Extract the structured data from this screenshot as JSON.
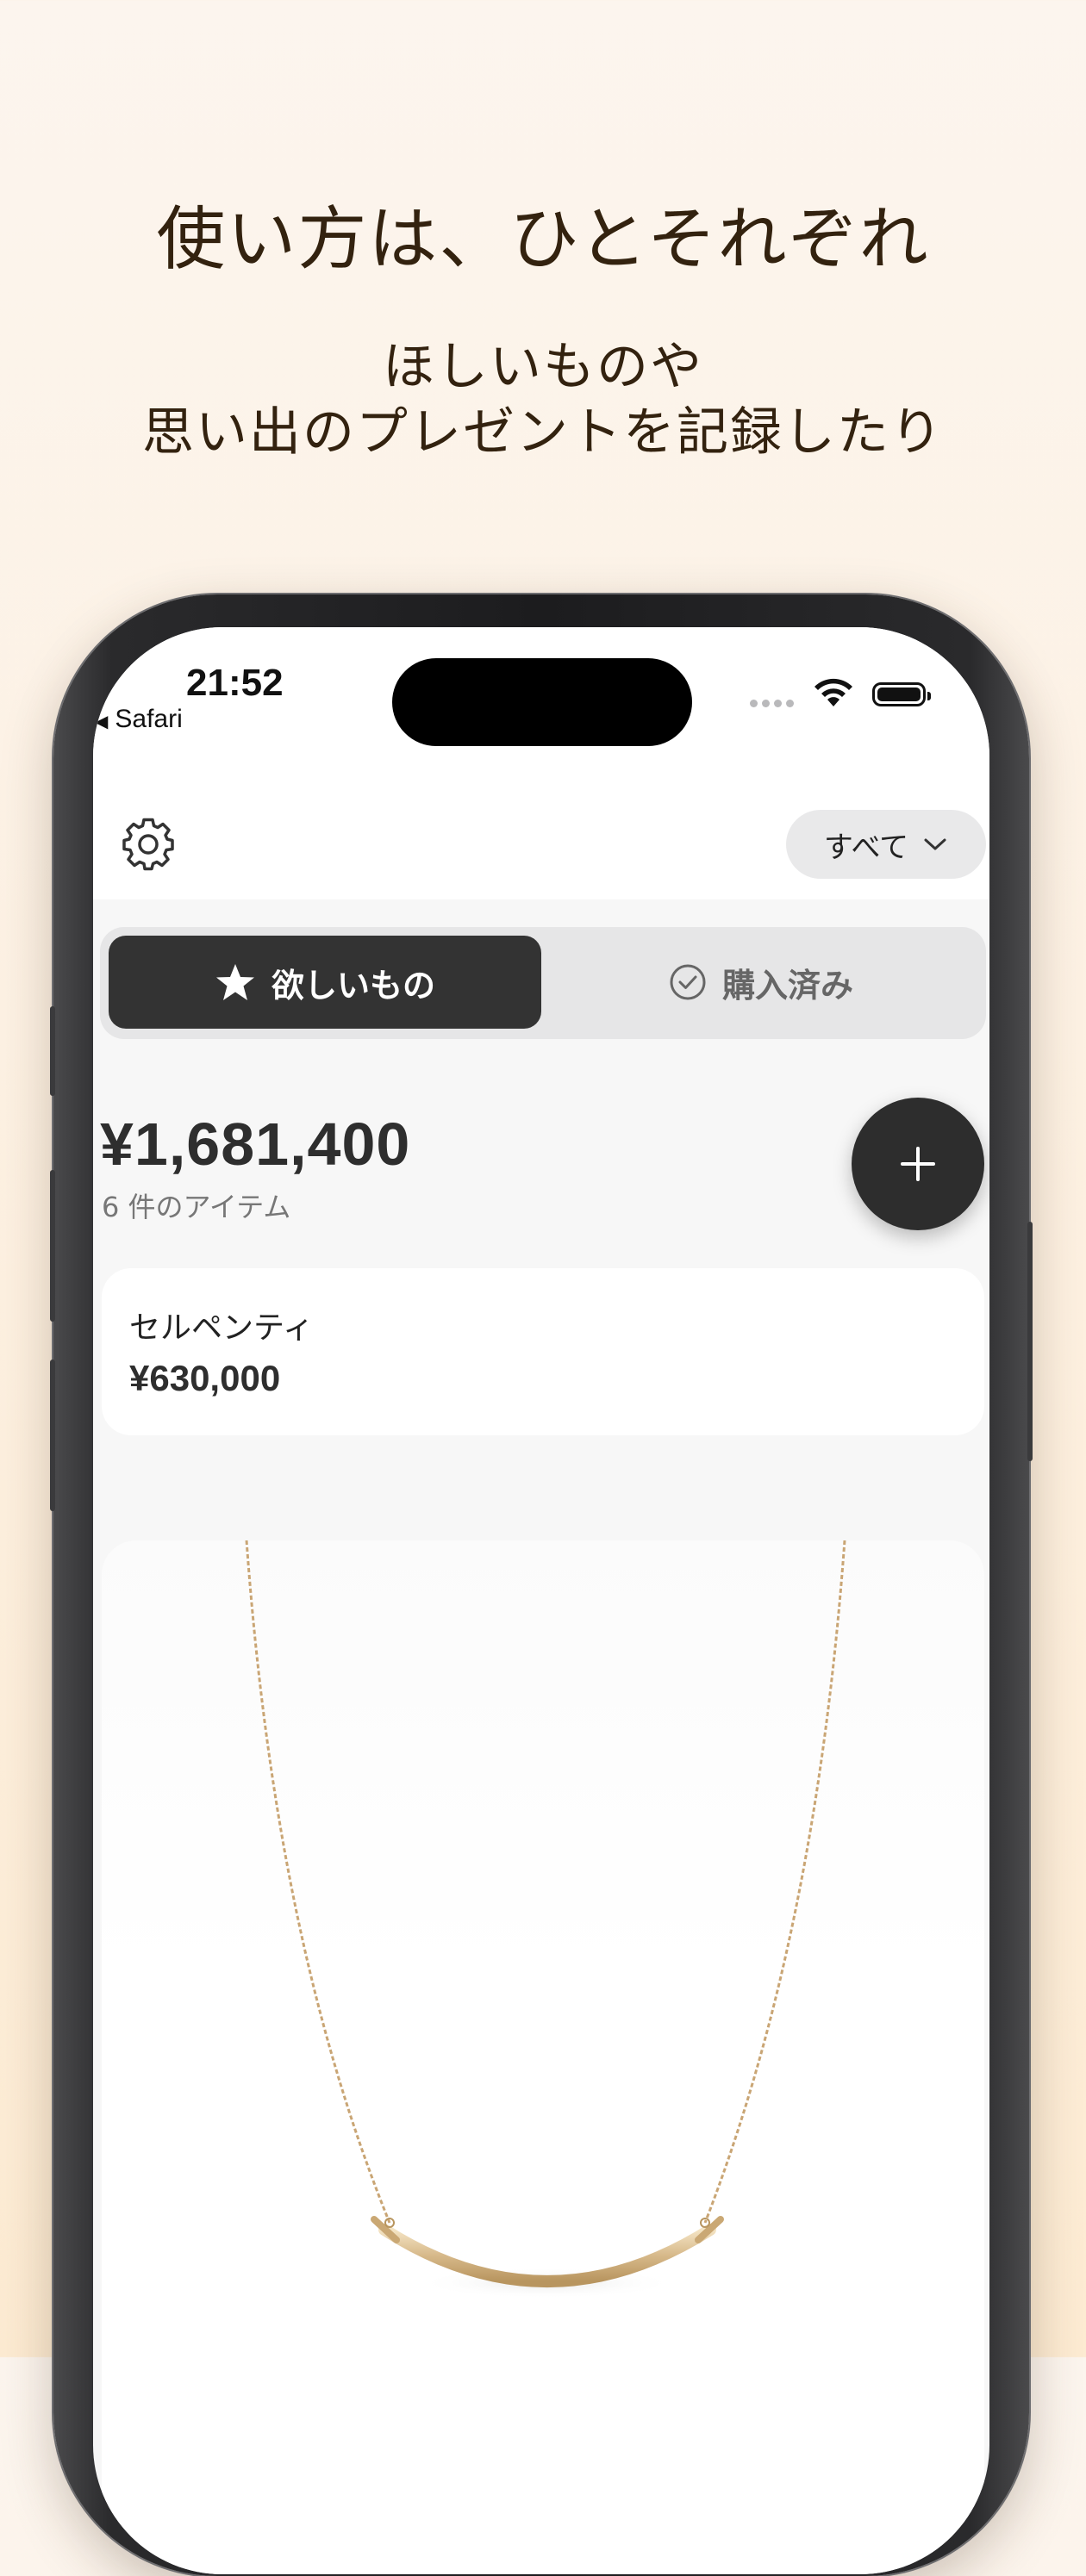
{
  "promo": {
    "headline": "使い方は、ひとそれぞれ",
    "subline_1": "ほしいものや",
    "subline_2": "思い出のプレゼントを記録したり"
  },
  "status_bar": {
    "time": "21:52",
    "back_app": "Safari",
    "battery_level": 1.0
  },
  "navbar": {
    "settings_icon": "gear-icon",
    "filter_label": "すべて",
    "filter_icon": "chevron-down-icon"
  },
  "tabs": {
    "wishlist_label": "欲しいもの",
    "wishlist_icon": "star-icon",
    "purchased_label": "購入済み",
    "purchased_icon": "check-circle-icon",
    "active": "wishlist"
  },
  "summary": {
    "total": "¥1,681,400",
    "count": "6 件のアイテム"
  },
  "add_button": {
    "icon": "plus-icon"
  },
  "items": [
    {
      "title": "セルペンティ",
      "price": "¥630,000"
    }
  ],
  "product_image": {
    "subject": "gold-necklace-image"
  },
  "colors": {
    "background_top": "#fcf5ee",
    "background_bottom": "#fdebd2",
    "headline": "#33220f",
    "active_tab": "#333333",
    "fab": "#2d2d2d"
  }
}
